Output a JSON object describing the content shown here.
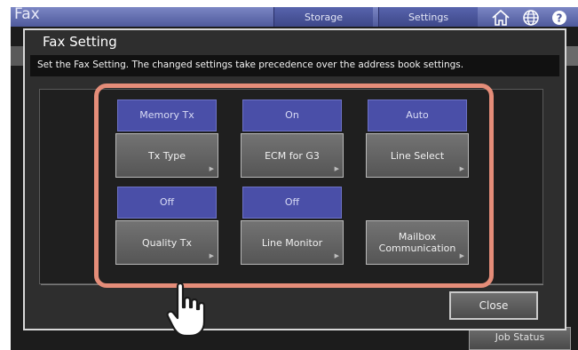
{
  "app": {
    "title": "Fax",
    "tabs": {
      "storage": "Storage",
      "settings": "Settings"
    },
    "icons": [
      "home-icon",
      "globe-icon",
      "help-icon"
    ],
    "job_status": "Job Status"
  },
  "dialog": {
    "title": "Fax Setting",
    "instruction": "Set the Fax Setting. The changed settings take precedence over the address book settings.",
    "settings": [
      {
        "value": "Memory Tx",
        "label": "Tx Type"
      },
      {
        "value": "On",
        "label": "ECM for G3"
      },
      {
        "value": "Auto",
        "label": "Line Select"
      },
      {
        "value": "Off",
        "label": "Quality Tx"
      },
      {
        "value": "Off",
        "label": "Line Monitor"
      },
      {
        "value": "",
        "label": "Mailbox\nCommunication"
      }
    ],
    "close": "Close"
  },
  "colors": {
    "highlight": "#e58d79",
    "value_blue": "#4a4fa8",
    "title_bar": "#5a65aa"
  }
}
